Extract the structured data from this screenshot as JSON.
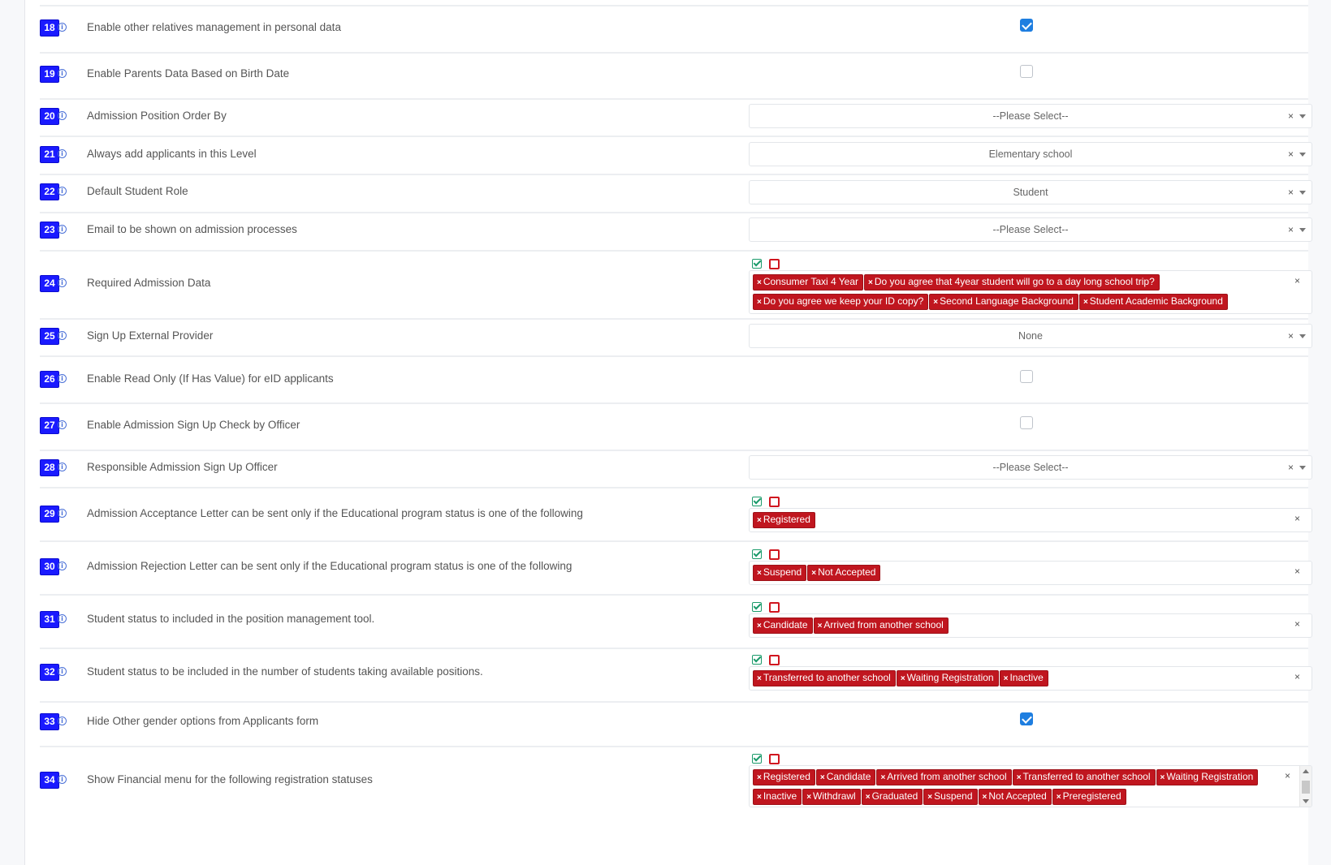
{
  "settings": [
    {
      "num": "18",
      "label": "Enable other relatives management in personal data",
      "type": "checkbox",
      "checked": true
    },
    {
      "num": "19",
      "label": "Enable Parents Data Based on Birth Date",
      "type": "checkbox",
      "checked": false
    },
    {
      "num": "20",
      "label": "Admission Position Order By",
      "type": "select",
      "value": "--Please Select--"
    },
    {
      "num": "21",
      "label": "Always add applicants in this Level",
      "type": "select",
      "value": "Elementary school"
    },
    {
      "num": "22",
      "label": "Default Student Role",
      "type": "select",
      "value": "Student"
    },
    {
      "num": "23",
      "label": "Email to be shown on admission processes",
      "type": "select",
      "value": "--Please Select--"
    },
    {
      "num": "24",
      "label": "Required Admission Data",
      "type": "multiselect",
      "tags": [
        "Consumer Taxi 4 Year",
        "Do you agree that 4year student will go to a day long school trip?",
        "Do you agree we keep your ID copy?",
        "Second Language Background",
        "Student Academic Background"
      ]
    },
    {
      "num": "25",
      "label": "Sign Up External Provider",
      "type": "select",
      "value": "None"
    },
    {
      "num": "26",
      "label": "Enable Read Only (If Has Value) for eID applicants",
      "type": "checkbox",
      "checked": false
    },
    {
      "num": "27",
      "label": "Enable Admission Sign Up Check by Officer",
      "type": "checkbox",
      "checked": false
    },
    {
      "num": "28",
      "label": "Responsible Admission Sign Up Officer",
      "type": "select",
      "value": "--Please Select--"
    },
    {
      "num": "29",
      "label": "Admission Acceptance Letter can be sent only if the Educational program status is one of the following",
      "type": "multiselect",
      "tags": [
        "Registered"
      ]
    },
    {
      "num": "30",
      "label": "Admission Rejection Letter can be sent only if the Educational program status is one of the following",
      "type": "multiselect",
      "tags": [
        "Suspend",
        "Not Accepted"
      ]
    },
    {
      "num": "31",
      "label": "Student status to included in the position management tool.",
      "type": "multiselect",
      "tags": [
        "Candidate",
        "Arrived from another school"
      ]
    },
    {
      "num": "32",
      "label": "Student status to be included in the number of students taking available positions.",
      "type": "multiselect",
      "tags": [
        "Transferred to another school",
        "Waiting Registration",
        "Inactive"
      ]
    },
    {
      "num": "33",
      "label": "Hide Other gender options from Applicants form",
      "type": "checkbox",
      "checked": true
    },
    {
      "num": "34",
      "label": "Show Financial menu for the following registration statuses",
      "type": "multiselect",
      "tags": [
        "Registered",
        "Candidate",
        "Arrived from another school",
        "Transferred to another school",
        "Waiting Registration",
        "Inactive",
        "Withdrawl",
        "Graduated",
        "Suspend",
        "Not Accepted",
        "Preregistered"
      ]
    }
  ],
  "icons": {
    "select_all": "check-square-icon",
    "deselect_all": "square-icon",
    "clear": "×",
    "info": "i"
  },
  "colors": {
    "number_badge": "#1a1aff",
    "tag": "#c0161f",
    "checkbox_checked": "#1e7ee0",
    "select_all_icon": "#1a9a6a"
  }
}
